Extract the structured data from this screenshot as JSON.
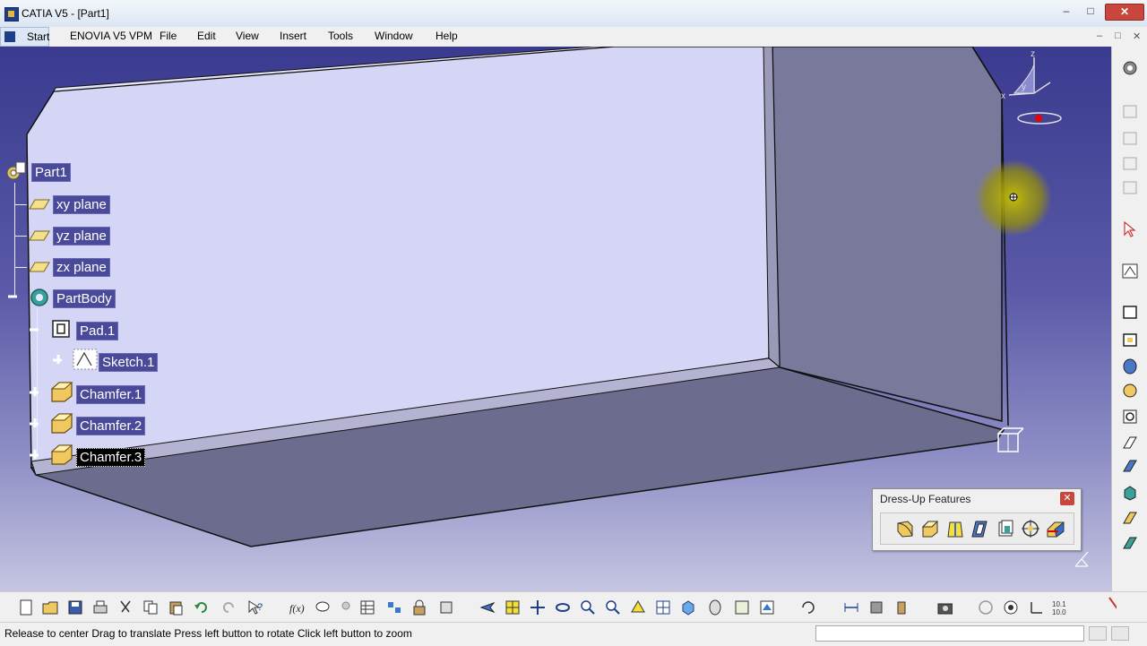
{
  "window": {
    "title": "CATIA V5 - [Part1]",
    "min": "–",
    "max": "□",
    "close": "✕"
  },
  "menu": {
    "start": "Start",
    "items": [
      "ENOVIA V5 VPM",
      "File",
      "Edit",
      "View",
      "Insert",
      "Tools",
      "Window",
      "Help"
    ],
    "mdi": [
      "–",
      "□",
      "✕"
    ]
  },
  "tree": {
    "root": "Part1",
    "planes": [
      "xy plane",
      "yz plane",
      "zx plane"
    ],
    "body": "PartBody",
    "pad": "Pad.1",
    "sketch": "Sketch.1",
    "chamfers": [
      "Chamfer.1",
      "Chamfer.2",
      "Chamfer.3"
    ],
    "selected": "Chamfer.3"
  },
  "compass": {
    "x": "x",
    "y": "y",
    "z": "z"
  },
  "dressup_panel": {
    "title": "Dress-Up Features",
    "close": "✕"
  },
  "statusbar": {
    "text": "Release to center  Drag to translate  Press left button to rotate  Click left button to zoom"
  },
  "colors": {
    "viewport_top": "#3a3a8f",
    "viewport_bottom": "#c5c5e2",
    "face_light": "#d5d5f5",
    "face_dark": "#76769a",
    "selection": "#000000"
  }
}
